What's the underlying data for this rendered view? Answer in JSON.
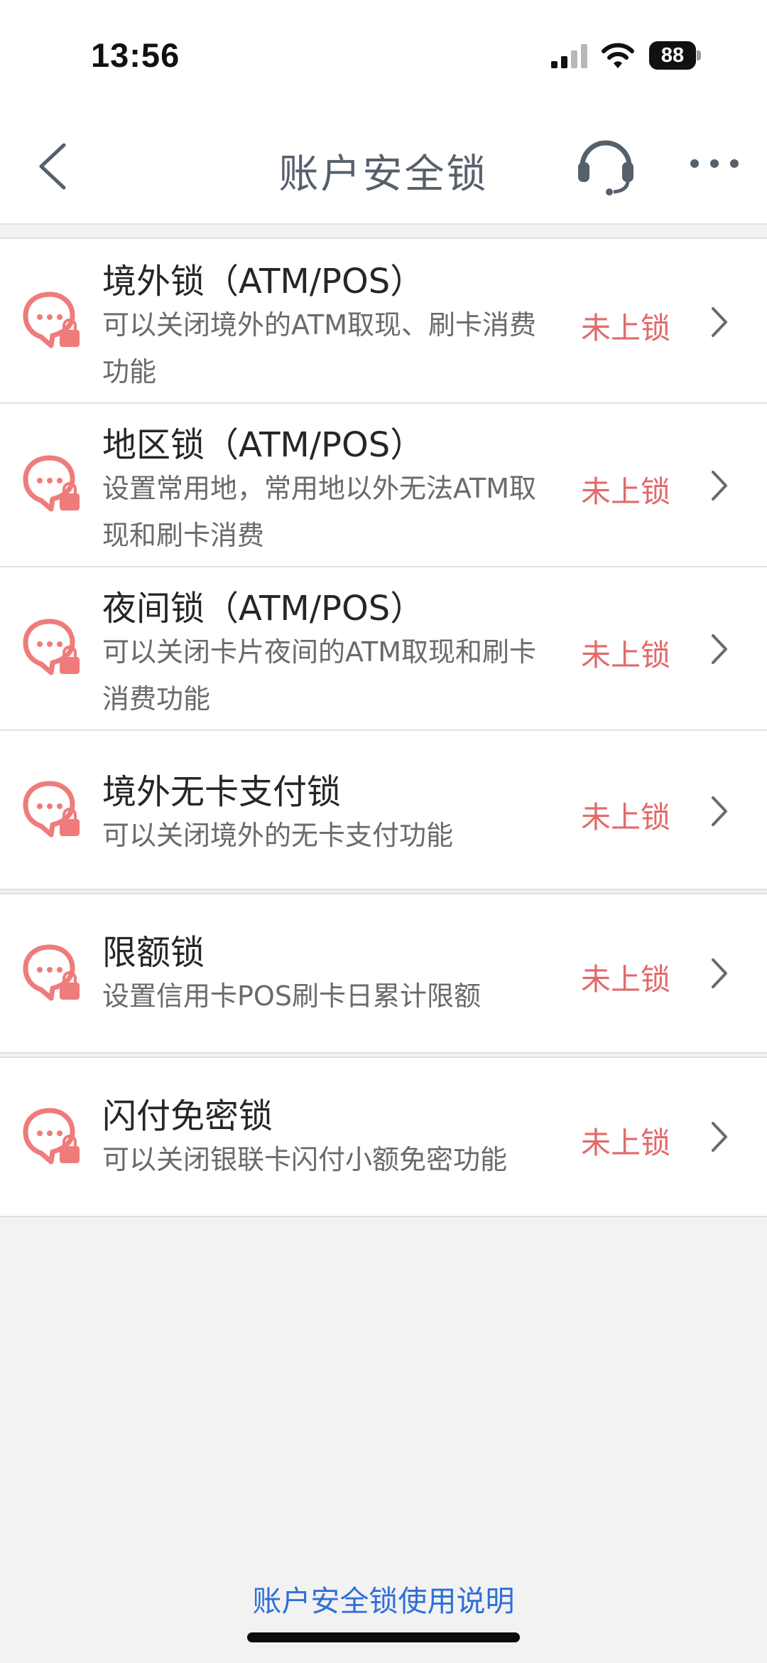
{
  "status_bar": {
    "time": "13:56",
    "battery": "88"
  },
  "nav": {
    "title": "账户安全锁"
  },
  "colors": {
    "accent_red": "#e26a6a",
    "link_blue": "#2f6fd6",
    "icon_pink": "#ef7b7b"
  },
  "locks": [
    {
      "title": "境外锁（ATM/POS）",
      "desc": "可以关闭境外的ATM取现、刷卡消费功能",
      "status": "未上锁",
      "icon": "lock-shield-icon"
    },
    {
      "title": "地区锁（ATM/POS）",
      "desc": "设置常用地，常用地以外无法ATM取现和刷卡消费",
      "status": "未上锁",
      "icon": "lock-shield-icon"
    },
    {
      "title": "夜间锁（ATM/POS）",
      "desc": "可以关闭卡片夜间的ATM取现和刷卡消费功能",
      "status": "未上锁",
      "icon": "lock-shield-icon"
    },
    {
      "title": "境外无卡支付锁",
      "desc": "可以关闭境外的无卡支付功能",
      "status": "未上锁",
      "icon": "lock-shield-icon"
    },
    {
      "title": "限额锁",
      "desc": "设置信用卡POS刷卡日累计限额",
      "status": "未上锁",
      "icon": "lock-shield-icon"
    },
    {
      "title": "闪付免密锁",
      "desc": "可以关闭银联卡闪付小额免密功能",
      "status": "未上锁",
      "icon": "lock-shield-icon"
    }
  ],
  "footer": {
    "help_link": "账户安全锁使用说明"
  }
}
